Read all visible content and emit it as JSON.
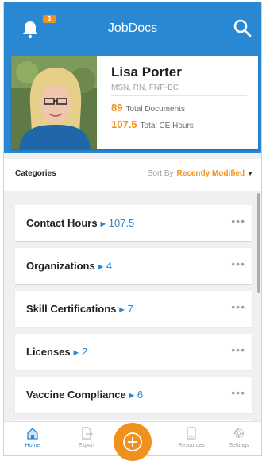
{
  "header": {
    "title": "JobDocs",
    "notification_badge": "3"
  },
  "profile": {
    "name": "Lisa Porter",
    "credentials": "MSN, RN, FNP-BC",
    "stats": [
      {
        "value": "89",
        "label": "Total Documents"
      },
      {
        "value": "107.5",
        "label": "Total CE Hours"
      }
    ]
  },
  "categories": {
    "title": "Categories",
    "sort_label": "Sort By",
    "sort_value": "Recently Modified",
    "items": [
      {
        "label": "Contact Hours",
        "count": "107.5"
      },
      {
        "label": "Organizations",
        "count": "4"
      },
      {
        "label": "Skill Certifications",
        "count": "7"
      },
      {
        "label": "Licenses",
        "count": "2"
      },
      {
        "label": "Vaccine Compliance",
        "count": "6"
      }
    ],
    "more_glyph": "•••"
  },
  "bottom_nav": {
    "items": [
      {
        "label": "Home",
        "icon": "home-icon"
      },
      {
        "label": "Export",
        "icon": "export-icon"
      },
      {
        "label": "Resources",
        "icon": "book-icon"
      },
      {
        "label": "Settings",
        "icon": "gear-icon"
      }
    ],
    "fab_icon": "plus-circle-icon"
  },
  "colors": {
    "primary": "#2a87d2",
    "accent": "#f0911d",
    "background": "#f0f0f3"
  }
}
